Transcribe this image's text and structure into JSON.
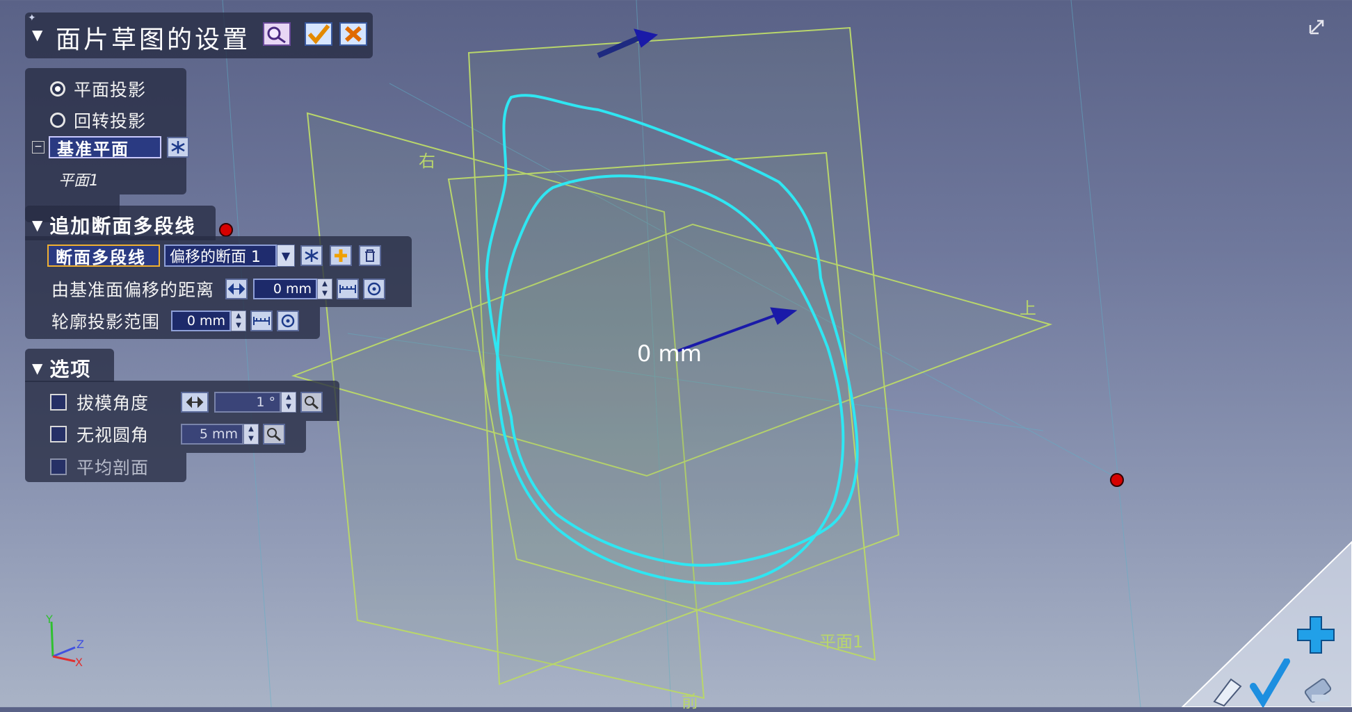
{
  "dialog": {
    "title": "面片草图的设置"
  },
  "projection": {
    "options": [
      {
        "label": "平面投影",
        "selected": true
      },
      {
        "label": "回转投影",
        "selected": false
      }
    ],
    "base_plane_tag": "基准平面",
    "base_plane_value": "平面1"
  },
  "section": {
    "header": "追加断面多段线",
    "polyline_tag": "断面多段线",
    "polyline_value": "偏移的断面 1",
    "offset_label": "由基准面偏移的距离",
    "offset_value": "0 mm",
    "range_label": "轮廓投影范围",
    "range_value": "0 mm"
  },
  "options": {
    "header": "选项",
    "draft_angle_label": "拔模角度",
    "draft_angle_value": "1 °",
    "ignore_fillet_label": "无视圆角",
    "ignore_fillet_value": "5 mm",
    "average_section_label": "平均剖面"
  },
  "viewport": {
    "center_readout": "0 mm",
    "plane_labels": {
      "right": "右",
      "top": "上",
      "plane1": "平面1",
      "front": "前"
    },
    "axes": {
      "y": "Y",
      "z": "Z",
      "x": "X"
    },
    "colors": {
      "plane": "#b9d66b",
      "curve": "#2fe6f2",
      "arrow": "#1a1aa8",
      "point": "#d60000"
    }
  }
}
